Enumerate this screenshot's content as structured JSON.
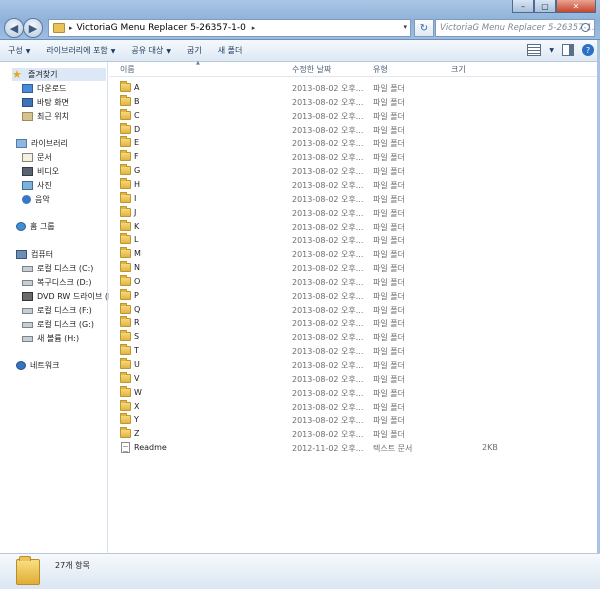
{
  "address": {
    "path": "VictoriaG Menu Replacer 5-26357-1-0",
    "search_placeholder": "VictoriaG Menu Replacer 5-26357-1..."
  },
  "toolbar": {
    "organize": "구성",
    "include_library": "라이브러리에 포함",
    "share": "공유 대상",
    "burn": "굽기",
    "new_folder": "새 폴더"
  },
  "navigation": {
    "favorites": "즐겨찾기",
    "downloads": "다운로드",
    "desktop": "바탕 화면",
    "recent": "최근 위치",
    "libraries": "라이브러리",
    "documents": "문서",
    "videos": "비디오",
    "pictures": "사진",
    "music": "음악",
    "homegroup": "홈 그룹",
    "computer": "컴퓨터",
    "drive_c": "로컬 디스크 (C:)",
    "drive_d": "복구디스크 (D:)",
    "drive_e": "DVD RW 드라이브 (E:)",
    "drive_f": "로컬 디스크 (F:)",
    "drive_g": "로컬 디스크 (G:)",
    "drive_h": "새 볼륨 (H:)",
    "network": "네트워크"
  },
  "columns": {
    "name": "이름",
    "date": "수정한 날짜",
    "type": "유형",
    "size": "크기"
  },
  "files": [
    {
      "name": "A",
      "date": "2013-08-02 오후...",
      "type": "파일 폴더",
      "size": "",
      "kind": "folder"
    },
    {
      "name": "B",
      "date": "2013-08-02 오후...",
      "type": "파일 폴더",
      "size": "",
      "kind": "folder"
    },
    {
      "name": "C",
      "date": "2013-08-02 오후...",
      "type": "파일 폴더",
      "size": "",
      "kind": "folder"
    },
    {
      "name": "D",
      "date": "2013-08-02 오후...",
      "type": "파일 폴더",
      "size": "",
      "kind": "folder"
    },
    {
      "name": "E",
      "date": "2013-08-02 오후...",
      "type": "파일 폴더",
      "size": "",
      "kind": "folder"
    },
    {
      "name": "F",
      "date": "2013-08-02 오후...",
      "type": "파일 폴더",
      "size": "",
      "kind": "folder"
    },
    {
      "name": "G",
      "date": "2013-08-02 오후...",
      "type": "파일 폴더",
      "size": "",
      "kind": "folder"
    },
    {
      "name": "H",
      "date": "2013-08-02 오후...",
      "type": "파일 폴더",
      "size": "",
      "kind": "folder"
    },
    {
      "name": "I",
      "date": "2013-08-02 오후...",
      "type": "파일 폴더",
      "size": "",
      "kind": "folder"
    },
    {
      "name": "J",
      "date": "2013-08-02 오후...",
      "type": "파일 폴더",
      "size": "",
      "kind": "folder"
    },
    {
      "name": "K",
      "date": "2013-08-02 오후...",
      "type": "파일 폴더",
      "size": "",
      "kind": "folder"
    },
    {
      "name": "L",
      "date": "2013-08-02 오후...",
      "type": "파일 폴더",
      "size": "",
      "kind": "folder"
    },
    {
      "name": "M",
      "date": "2013-08-02 오후...",
      "type": "파일 폴더",
      "size": "",
      "kind": "folder"
    },
    {
      "name": "N",
      "date": "2013-08-02 오후...",
      "type": "파일 폴더",
      "size": "",
      "kind": "folder"
    },
    {
      "name": "O",
      "date": "2013-08-02 오후...",
      "type": "파일 폴더",
      "size": "",
      "kind": "folder"
    },
    {
      "name": "P",
      "date": "2013-08-02 오후...",
      "type": "파일 폴더",
      "size": "",
      "kind": "folder"
    },
    {
      "name": "Q",
      "date": "2013-08-02 오후...",
      "type": "파일 폴더",
      "size": "",
      "kind": "folder"
    },
    {
      "name": "R",
      "date": "2013-08-02 오후...",
      "type": "파일 폴더",
      "size": "",
      "kind": "folder"
    },
    {
      "name": "S",
      "date": "2013-08-02 오후...",
      "type": "파일 폴더",
      "size": "",
      "kind": "folder"
    },
    {
      "name": "T",
      "date": "2013-08-02 오후...",
      "type": "파일 폴더",
      "size": "",
      "kind": "folder"
    },
    {
      "name": "U",
      "date": "2013-08-02 오후...",
      "type": "파일 폴더",
      "size": "",
      "kind": "folder"
    },
    {
      "name": "V",
      "date": "2013-08-02 오후...",
      "type": "파일 폴더",
      "size": "",
      "kind": "folder"
    },
    {
      "name": "W",
      "date": "2013-08-02 오후...",
      "type": "파일 폴더",
      "size": "",
      "kind": "folder"
    },
    {
      "name": "X",
      "date": "2013-08-02 오후...",
      "type": "파일 폴더",
      "size": "",
      "kind": "folder"
    },
    {
      "name": "Y",
      "date": "2013-08-02 오후...",
      "type": "파일 폴더",
      "size": "",
      "kind": "folder"
    },
    {
      "name": "Z",
      "date": "2013-08-02 오후...",
      "type": "파일 폴더",
      "size": "",
      "kind": "folder"
    },
    {
      "name": "Readme",
      "date": "2012-11-02 오후...",
      "type": "텍스트 문서",
      "size": "2KB",
      "kind": "text"
    }
  ],
  "status": {
    "item_count": "27개 항목"
  },
  "icons": {
    "back": "back-arrow-icon",
    "forward": "forward-arrow-icon",
    "refresh": "refresh-icon",
    "search": "search-icon",
    "folder": "folder-icon",
    "text_file": "text-file-icon"
  }
}
